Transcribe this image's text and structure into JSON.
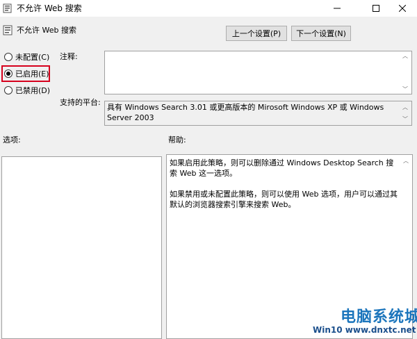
{
  "window": {
    "title": "不允许 Web 搜索",
    "icon": "policy-icon"
  },
  "header": {
    "title": "不允许 Web 搜索",
    "icon": "policy-icon"
  },
  "nav": {
    "prev_label": "上一个设置(P)",
    "next_label": "下一个设置(N)"
  },
  "options": [
    {
      "label": "未配置(C)",
      "selected": false
    },
    {
      "label": "已启用(E)",
      "selected": true
    },
    {
      "label": "已禁用(D)",
      "selected": false
    }
  ],
  "fields": {
    "note_label": "注释:",
    "note_value": "",
    "platform_label": "支持的平台:",
    "platform_value": "具有 Windows Search 3.01 或更高版本的 Mirosoft Windows XP 或 Windows Server 2003"
  },
  "sections": {
    "options_label": "选项:",
    "help_label": "帮助:"
  },
  "help": {
    "p1": "如果启用此策略，则可以删除通过 Windows Desktop Search 搜索 Web 这一选项。",
    "p2": "如果禁用或未配置此策略，则可以使用 Web 选项，用户可以通过其默认的浏览器搜索引擎来搜索 Web。"
  },
  "watermark": {
    "big": "电脑系统城",
    "small": "Win10 www.dnxtc.net"
  },
  "colors": {
    "highlight": "#d6001c",
    "watermark": "#1b75bc"
  }
}
